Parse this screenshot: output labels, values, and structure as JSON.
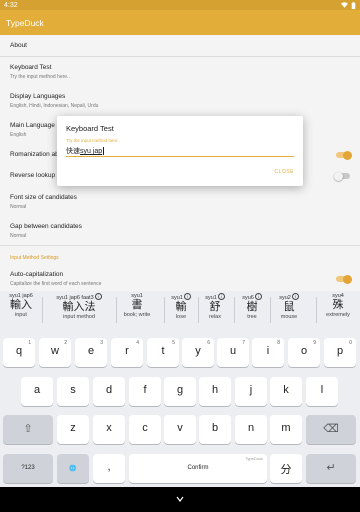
{
  "status_bar": {
    "time": "4:32"
  },
  "app": {
    "title": "TypeDuck"
  },
  "settings": {
    "about": "About",
    "keyboard_test": {
      "title": "Keyboard Test",
      "summary": "Try the input method here.."
    },
    "display_languages": {
      "title": "Display Languages",
      "summary": "English, Hindi, Indonesian, Nepali, Urdu"
    },
    "main_language": {
      "title": "Main Language",
      "summary": "English"
    },
    "romanization": {
      "title": "Romanization ab",
      "enabled": true
    },
    "reverse_lookup": {
      "title": "Reverse lookup c",
      "enabled": false
    },
    "font_size": {
      "title": "Font size of candidates",
      "summary": "Normal"
    },
    "gap": {
      "title": "Gap between candidates",
      "summary": "Normal"
    },
    "category_input_method": "Input Method Settings",
    "auto_cap": {
      "title": "Auto-capitalization",
      "summary": "Capitalize the first word of each sentence",
      "enabled": true
    }
  },
  "dialog": {
    "title": "Keyboard Test",
    "hint": "Try the input method here..",
    "committed_text": "快速",
    "composing_text": "syu jap",
    "close_label": "CLOSE"
  },
  "candidates": [
    {
      "jyutping": "syu1 jap6",
      "hanzi": "輸入",
      "gloss": "input",
      "info": ""
    },
    {
      "jyutping": "syu1 jap6 faat3",
      "hanzi": "輸入法",
      "gloss": "input method",
      "info": "i"
    },
    {
      "jyutping": "syu1",
      "hanzi": "書",
      "gloss": "book; write",
      "info": ""
    },
    {
      "jyutping": "syu1",
      "hanzi": "輸",
      "gloss": "lose",
      "info": "i"
    },
    {
      "jyutping": "syu1",
      "hanzi": "舒",
      "gloss": "relax",
      "info": "i"
    },
    {
      "jyutping": "syu6",
      "hanzi": "樹",
      "gloss": "tree",
      "info": "i"
    },
    {
      "jyutping": "syu2",
      "hanzi": "鼠",
      "gloss": "mouse",
      "info": "i"
    },
    {
      "jyutping": "syu4",
      "hanzi": "殊",
      "gloss": "extremely",
      "info": ""
    }
  ],
  "keyboard": {
    "row1": [
      {
        "label": "q",
        "hint": "1"
      },
      {
        "label": "w",
        "hint": "2"
      },
      {
        "label": "e",
        "hint": "3"
      },
      {
        "label": "r",
        "hint": "4"
      },
      {
        "label": "t",
        "hint": "5"
      },
      {
        "label": "y",
        "hint": "6"
      },
      {
        "label": "u",
        "hint": "7"
      },
      {
        "label": "i",
        "hint": "8"
      },
      {
        "label": "o",
        "hint": "9"
      },
      {
        "label": "p",
        "hint": "0"
      }
    ],
    "row2": [
      "a",
      "s",
      "d",
      "f",
      "g",
      "h",
      "j",
      "k",
      "l"
    ],
    "row3": [
      "z",
      "x",
      "c",
      "v",
      "b",
      "n",
      "m"
    ],
    "shift": "⇧",
    "backspace": "⌫",
    "symbols": "?123",
    "globe": "🌐",
    "comma": ",",
    "space": "Confirm",
    "space_brand": "TypeDuck",
    "lang": "分",
    "period": ".",
    "enter": "↵"
  }
}
